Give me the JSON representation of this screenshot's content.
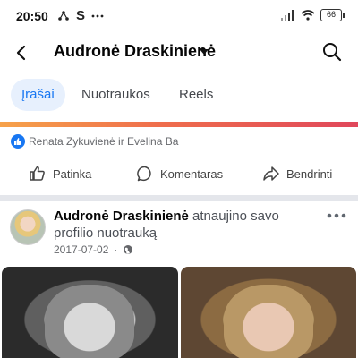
{
  "status_bar": {
    "time": "20:50",
    "left_icons": [
      "share-icon",
      "s-icon",
      "ellipsis-icon"
    ],
    "signal_icon": "signal-icon",
    "wifi_icon": "wifi-icon",
    "battery": "66"
  },
  "header": {
    "title": "Audronė Draskinienė",
    "back_icon": "back-arrow-icon",
    "dropdown_icon": "chevron-down-icon",
    "search_icon": "search-icon"
  },
  "tabs": [
    {
      "label": "Įrašai",
      "active": true
    },
    {
      "label": "Nuotraukos",
      "active": false
    },
    {
      "label": "Reels",
      "active": false
    }
  ],
  "reactions": {
    "icon": "like-badge-icon",
    "text": "Renata Zykuvienė ir Evelina Ba"
  },
  "actions": [
    {
      "label": "Patinka",
      "icon": "thumbs-up-icon"
    },
    {
      "label": "Komentaras",
      "icon": "comment-icon"
    },
    {
      "label": "Bendrinti",
      "icon": "share-icon"
    }
  ],
  "post": {
    "author": "Audronė Draskinienė",
    "action": "atnaujino savo profilio nuotrauką",
    "date": "2017-07-02",
    "separator": "·",
    "privacy_icon": "globe-icon",
    "more_icon": "more-options-icon",
    "photos": [
      {
        "style": "black-and-white"
      },
      {
        "style": "color"
      }
    ]
  },
  "colors": {
    "accent": "#1877f2",
    "tab_active_bg": "#e7f0fd",
    "text_secondary": "#65676b"
  }
}
